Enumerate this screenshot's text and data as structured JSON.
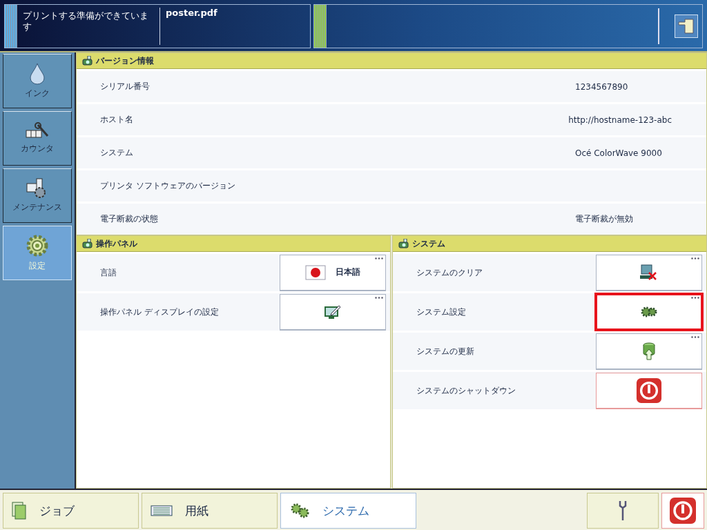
{
  "status_bar": {
    "message": "プリントする準備ができています",
    "file": "poster.pdf"
  },
  "sidebar": {
    "items": [
      {
        "label": "インク",
        "kind": "ink",
        "selected": false
      },
      {
        "label": "カウンタ",
        "kind": "counter",
        "selected": false
      },
      {
        "label": "メンテナンス",
        "kind": "maintenance",
        "selected": false
      },
      {
        "label": "設定",
        "kind": "settings",
        "selected": true
      }
    ]
  },
  "version_info": {
    "title": "バージョン情報",
    "rows": [
      {
        "label": "シリアル番号",
        "value": "1234567890"
      },
      {
        "label": "ホスト名",
        "value": "http://hostname-123-abc"
      },
      {
        "label": "システム",
        "value": "Océ ColorWave 9000"
      },
      {
        "label": "プリンタ ソフトウェアのバージョン"
      },
      {
        "label": "電子断裁の状態",
        "value": "電子断裁が無効"
      }
    ]
  },
  "control_panel": {
    "title": "操作パネル",
    "rows": [
      {
        "label": "言語",
        "kind": "flag",
        "value": "日本語",
        "more": true,
        "highlighted": false
      },
      {
        "label": "操作パネル ディスプレイの設定",
        "kind": "display",
        "more": true,
        "highlighted": false
      }
    ]
  },
  "system": {
    "title": "システム",
    "rows": [
      {
        "label": "システムのクリア",
        "kind": "clear",
        "more": true,
        "highlighted": false
      },
      {
        "label": "システム設定",
        "kind": "gear",
        "more": true,
        "highlighted": true
      },
      {
        "label": "システムの更新",
        "kind": "update",
        "more": true,
        "highlighted": false
      },
      {
        "label": "システムのシャットダウン",
        "kind": "shutdown",
        "more": false,
        "highlighted": false
      }
    ]
  },
  "bottom_tabs": [
    {
      "label": "ジョブ",
      "kind": "job",
      "selected": false
    },
    {
      "label": "用紙",
      "kind": "paper",
      "selected": false
    },
    {
      "label": "システム",
      "kind": "system",
      "selected": true
    }
  ]
}
